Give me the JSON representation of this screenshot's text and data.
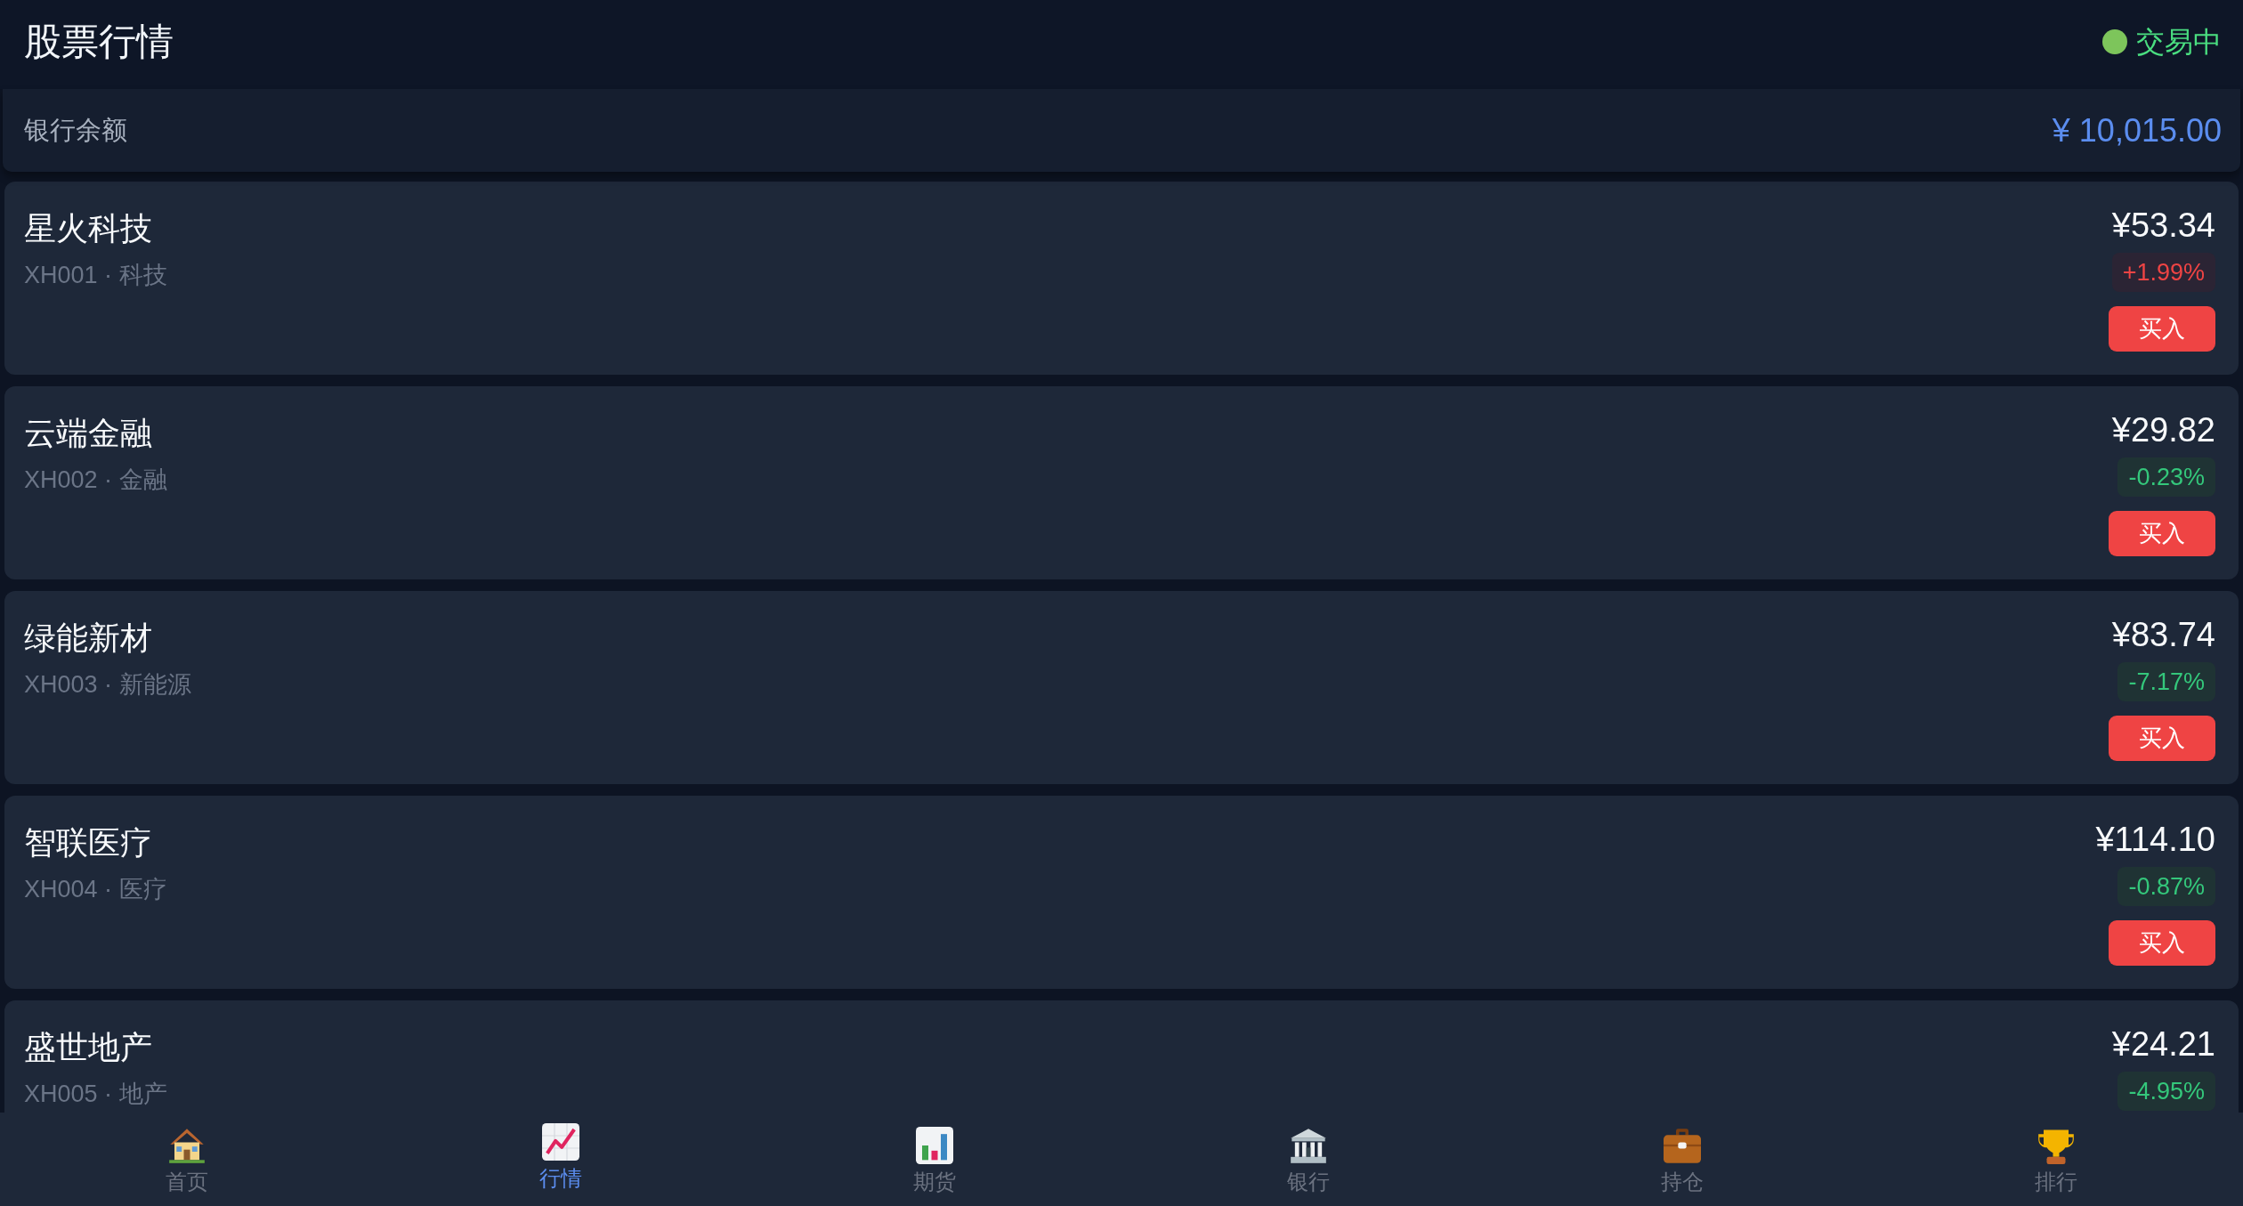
{
  "header": {
    "title": "股票行情",
    "status": {
      "label": "交易中",
      "active": true
    }
  },
  "balance": {
    "label": "银行余额",
    "amount": "¥ 10,015.00"
  },
  "stocks": [
    {
      "name": "星火科技",
      "code": "XH001 · 科技",
      "price": "¥53.34",
      "change": "+1.99%",
      "rising": true,
      "buy_label": "买入"
    },
    {
      "name": "云端金融",
      "code": "XH002 · 金融",
      "price": "¥29.82",
      "change": "-0.23%",
      "rising": false,
      "buy_label": "买入"
    },
    {
      "name": "绿能新材",
      "code": "XH003 · 新能源",
      "price": "¥83.74",
      "change": "-7.17%",
      "rising": false,
      "buy_label": "买入"
    },
    {
      "name": "智联医疗",
      "code": "XH004 · 医疗",
      "price": "¥114.10",
      "change": "-0.87%",
      "rising": false,
      "buy_label": "买入"
    },
    {
      "name": "盛世地产",
      "code": "XH005 · 地产",
      "price": "¥24.21",
      "change": "-4.95%",
      "rising": false
    }
  ],
  "nav": {
    "items": [
      {
        "label": "首页",
        "selected": false
      },
      {
        "label": "行情",
        "selected": true
      },
      {
        "label": "期货",
        "selected": false
      },
      {
        "label": "银行",
        "selected": false
      },
      {
        "label": "持仓",
        "selected": false
      },
      {
        "label": "排行",
        "selected": false
      }
    ]
  }
}
